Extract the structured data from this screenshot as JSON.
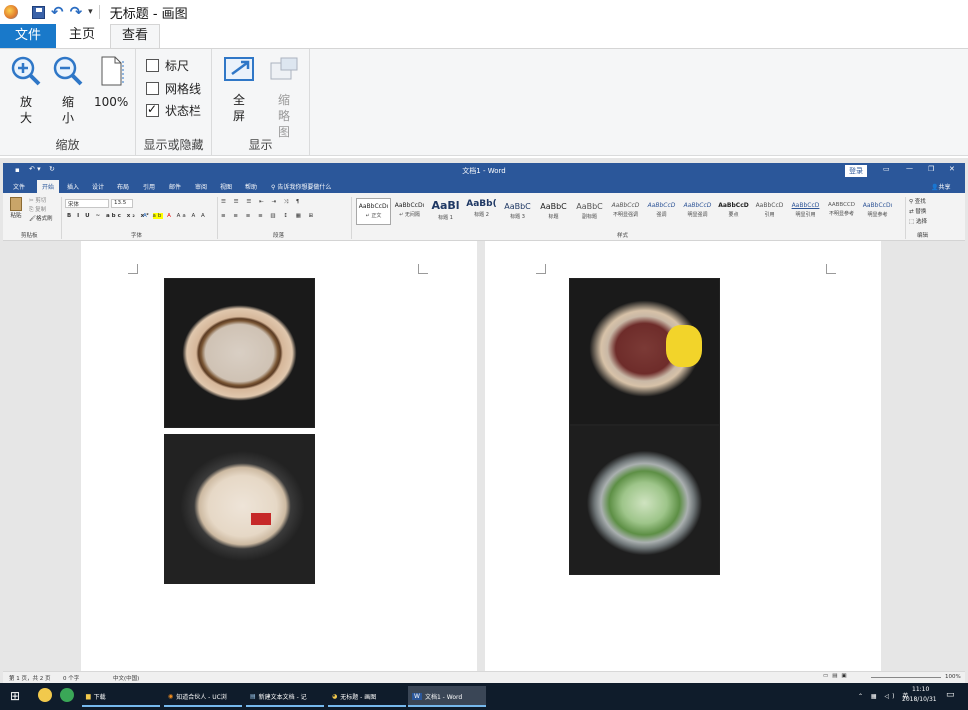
{
  "paint": {
    "title": "无标题 - 画图",
    "tabs": {
      "file": "文件",
      "home": "主页",
      "view": "查看"
    },
    "zoom": {
      "zoom_in": "放大",
      "zoom_out": "缩小",
      "hundred": "100%",
      "group": "缩放"
    },
    "show_hide": {
      "ruler": "标尺",
      "gridlines": "网格线",
      "statusbar": "状态栏",
      "ruler_checked": false,
      "gridlines_checked": false,
      "statusbar_checked": true,
      "group": "显示或隐藏"
    },
    "display": {
      "fullscreen": "全屏",
      "thumbnail": "缩略图",
      "group": "显示"
    }
  },
  "word": {
    "title": "文档1 - Word",
    "login": "登录",
    "share": "共享",
    "tabs": [
      "文件",
      "开始",
      "插入",
      "设计",
      "布局",
      "引用",
      "邮件",
      "审阅",
      "视图",
      "帮助"
    ],
    "tell_me": "告诉我你想要做什么",
    "clipboard": {
      "paste": "粘贴",
      "cut": "剪切",
      "copy": "复制",
      "format_painter": "格式刷",
      "group": "剪贴板"
    },
    "font": {
      "name": "宋体",
      "size": "13.5",
      "group": "字体"
    },
    "paragraph": {
      "group": "段落"
    },
    "styles": {
      "group": "样式",
      "items": [
        {
          "preview": "AaBbCcDı",
          "name": "↵ 正文"
        },
        {
          "preview": "AaBbCcDı",
          "name": "↵ 无间隔"
        },
        {
          "preview": "AaBl",
          "name": "标题 1"
        },
        {
          "preview": "AaBb(",
          "name": "标题 2"
        },
        {
          "preview": "AaBbC",
          "name": "标题 3"
        },
        {
          "preview": "AaBbC",
          "name": "标题"
        },
        {
          "preview": "AaBbC",
          "name": "副标题"
        },
        {
          "preview": "AaBbCcD",
          "name": "不明显强调"
        },
        {
          "preview": "AaBbCcD",
          "name": "强调"
        },
        {
          "preview": "AaBbCcD",
          "name": "明显强调"
        },
        {
          "preview": "AaBbCcD",
          "name": "要点"
        },
        {
          "preview": "AaBbCcD",
          "name": "引用"
        },
        {
          "preview": "AaBbCcD",
          "name": "明显引用"
        },
        {
          "preview": "AABBCCD",
          "name": "不明显参考"
        },
        {
          "preview": "AaBbCcDı",
          "name": "明显参考"
        }
      ]
    },
    "editing": {
      "find": "查找",
      "replace": "替换",
      "select": "选择",
      "group": "编辑"
    },
    "status": {
      "page": "第 1 页，共 2 页",
      "words": "0 个字",
      "lang": "中文(中国)",
      "zoom": "100%"
    }
  },
  "taskbar": {
    "items": [
      {
        "label": "下载"
      },
      {
        "label": "知道合伙人 - UC浏"
      },
      {
        "label": "新建文本文档 - 记"
      },
      {
        "label": "无标题 - 画图"
      },
      {
        "label": "文档1 - Word"
      }
    ],
    "time": "11:10",
    "date": "2018/10/31"
  }
}
